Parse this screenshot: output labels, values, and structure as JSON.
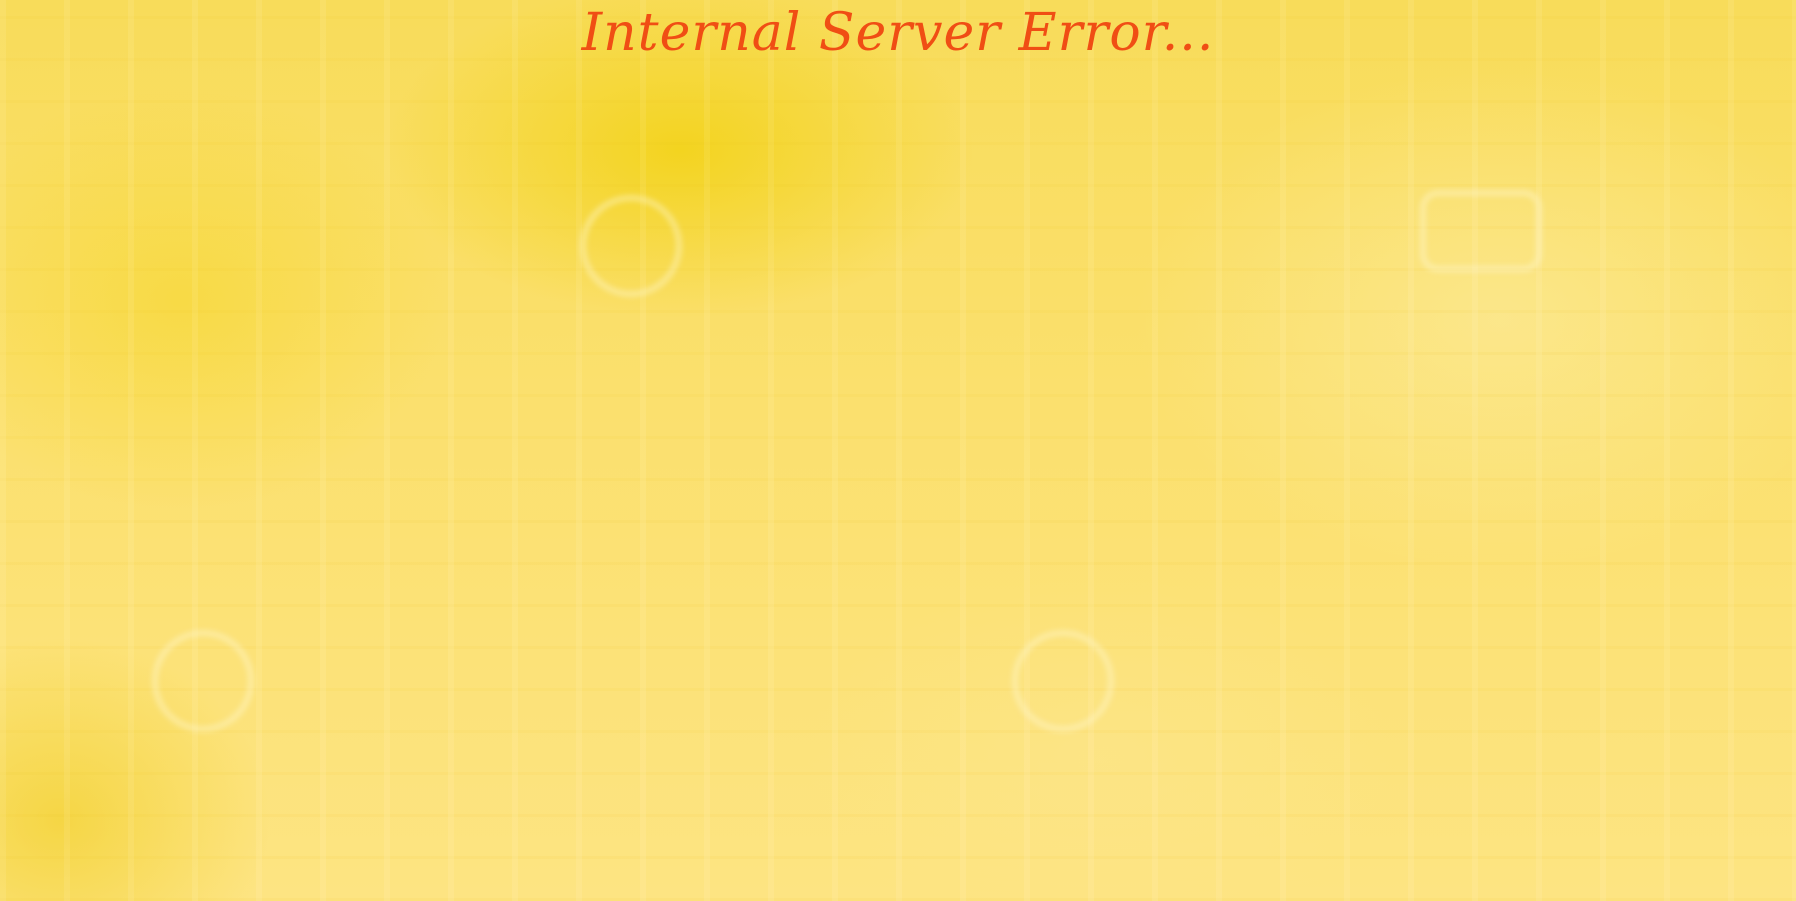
{
  "page": {
    "title": "Internal Server Error...",
    "title_color": "#f04e14",
    "background_color": "#fbe27a"
  }
}
